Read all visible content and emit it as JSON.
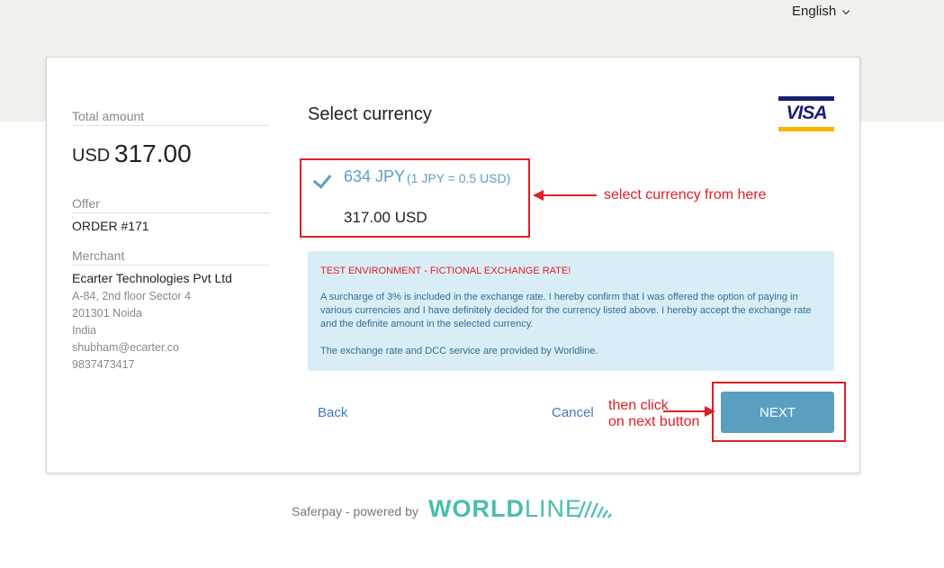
{
  "header": {
    "language": "English"
  },
  "summary": {
    "total_label": "Total amount",
    "currency": "USD",
    "amount": "317.00",
    "offer_label": "Offer",
    "offer_value": "ORDER #171",
    "merchant_label": "Merchant",
    "merchant_name": "Ecarter Technologies Pvt Ltd",
    "address_line1": "A-84, 2nd floor Sector 4",
    "address_line2": "201301 Noida",
    "country": "India",
    "email": "shubham@ecarter.co",
    "phone": "9837473417"
  },
  "main": {
    "title": "Select currency",
    "card_brand": "VISA",
    "option_amount": "634 JPY",
    "option_rate": "(1 JPY = 0.5 USD)",
    "option_original": "317.00 USD"
  },
  "info": {
    "warning": "TEST ENVIRONMENT - FICTIONAL EXCHANGE RATE!",
    "paragraph1": "A surcharge of 3% is included in the exchange rate. I hereby confirm that I was offered the option of paying in various currencies and I have definitely decided for the currency listed above. I hereby accept the exchange rate and the definite amount in the selected currency.",
    "paragraph2": "The exchange rate and DCC service are provided by Worldline."
  },
  "actions": {
    "back": "Back",
    "cancel": "Cancel",
    "next": "NEXT"
  },
  "annotations": {
    "select_hint": "select currency from here",
    "next_hint_line1": "then click",
    "next_hint_line2": "on next button"
  },
  "footer": {
    "powered_by": "Saferpay - powered by",
    "brand_bold": "WORLD",
    "brand_light": "LINE"
  },
  "colors": {
    "accent": "#5b9fc0",
    "annotation_red": "#e01f26",
    "info_bg": "#d9edf6",
    "worldline": "#46bfad"
  }
}
